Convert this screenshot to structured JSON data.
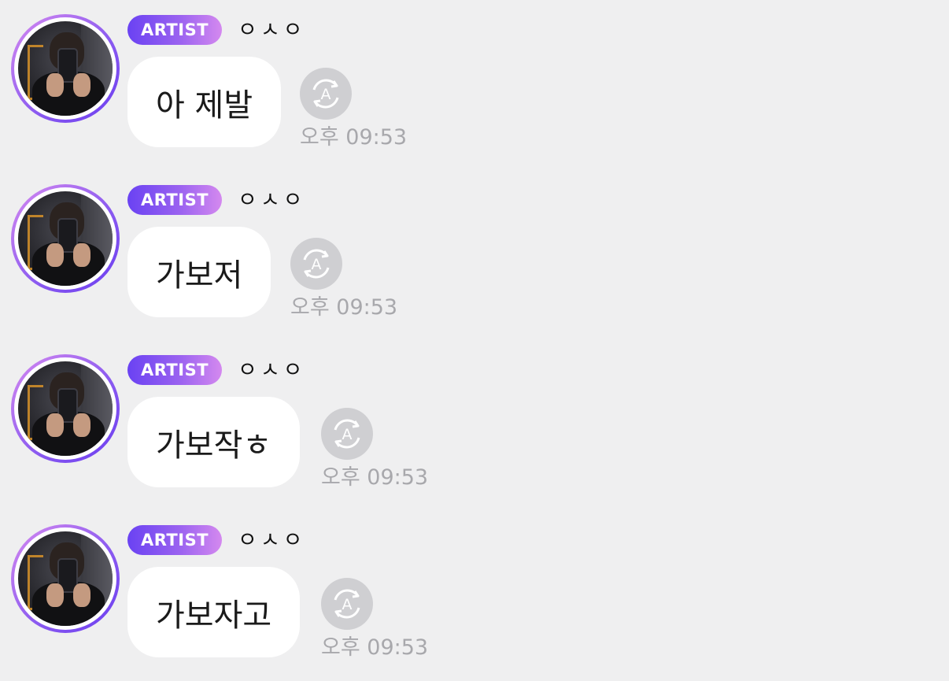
{
  "messages": [
    {
      "badge": "ARTIST",
      "name": "ㅇㅅㅇ",
      "text": "아 제발",
      "time": "오후 09:53",
      "avatar_icon": "profile-photo",
      "translate_icon": "translate-icon"
    },
    {
      "badge": "ARTIST",
      "name": "ㅇㅅㅇ",
      "text": "가보저",
      "time": "오후 09:53",
      "avatar_icon": "profile-photo",
      "translate_icon": "translate-icon"
    },
    {
      "badge": "ARTIST",
      "name": "ㅇㅅㅇ",
      "text": "가보작ㅎ",
      "time": "오후 09:53",
      "avatar_icon": "profile-photo",
      "translate_icon": "translate-icon"
    },
    {
      "badge": "ARTIST",
      "name": "ㅇㅅㅇ",
      "text": "가보자고",
      "time": "오후 09:53",
      "avatar_icon": "profile-photo",
      "translate_icon": "translate-icon"
    }
  ],
  "colors": {
    "background": "#efeff0",
    "badge_start": "#6a42f2",
    "badge_end": "#d489ef",
    "bubble": "#ffffff",
    "time": "#a8a8ac",
    "translate_button": "#cfcfd2"
  }
}
